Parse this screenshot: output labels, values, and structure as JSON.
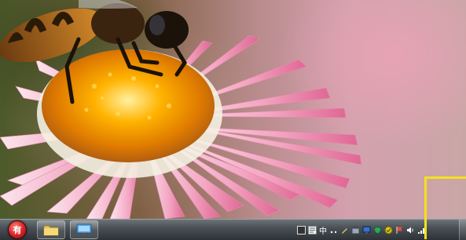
{
  "desktop": {
    "wallpaper": "bee-on-pink-flower",
    "selection_color": "#f6e11a"
  },
  "taskbar": {
    "start_button": {
      "label": "有",
      "color": "#d9262b",
      "icon": "start-orb"
    },
    "pinned": [
      {
        "name": "windows-explorer",
        "icon": "folder-icon"
      },
      {
        "name": "show-desktop-app",
        "icon": "monitor-icon"
      }
    ],
    "tray": {
      "language_label": "中",
      "icons": [
        "keyboard-icon",
        "input-method-icon",
        "punctuation-icon",
        "settings-icon",
        "toolbox-icon",
        "network-app-icon",
        "shield-icon",
        "security-icon",
        "flag-icon",
        "volume-icon",
        "signal-icon"
      ]
    }
  }
}
